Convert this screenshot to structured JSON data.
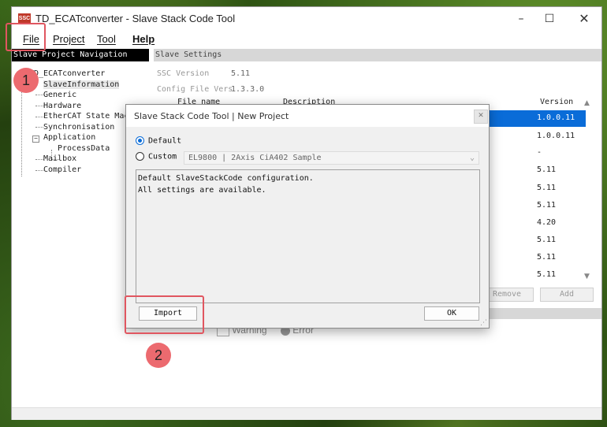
{
  "window": {
    "app_icon_text": "SSC",
    "title": "TD_ECATconverter - Slave Stack Code Tool",
    "controls": {
      "minimize": "–",
      "maximize": "☐",
      "close": "✕"
    }
  },
  "menubar": {
    "items": [
      {
        "label": "File"
      },
      {
        "label": "Project"
      },
      {
        "label": "Tool"
      },
      {
        "label": "Help"
      }
    ]
  },
  "navigation": {
    "header": "Slave Project Navigation",
    "tree": [
      {
        "label": "TD_ECATconverter"
      },
      {
        "label": "SlaveInformation"
      },
      {
        "label": "Generic"
      },
      {
        "label": "Hardware"
      },
      {
        "label": "EtherCAT State Machine"
      },
      {
        "label": "Synchronisation"
      },
      {
        "label": "Application"
      },
      {
        "label": "ProcessData"
      },
      {
        "label": "Mailbox"
      },
      {
        "label": "Compiler"
      }
    ]
  },
  "settings": {
    "header": "Slave Settings",
    "ssc_version_label": "SSC Version",
    "ssc_version_value": "5.11",
    "config_file_label": "Config File Vers",
    "config_file_value": "1.3.3.0",
    "columns": {
      "file_name": "File name",
      "description": "Description",
      "version": "Version"
    },
    "versions": [
      "1.0.0.11",
      "1.0.0.11",
      "-",
      "5.11",
      "5.11",
      "5.11",
      "4.20",
      "5.11",
      "5.11",
      "5.11"
    ],
    "remove_label": "Remove",
    "add_label": "Add"
  },
  "status": {
    "warning": "Warning",
    "error": "Error"
  },
  "dialog": {
    "title": "Slave Stack Code Tool | New Project",
    "default_label": "Default",
    "custom_label": "Custom",
    "custom_selected": "EL9800 | 2Axis CiA402 Sample",
    "description_lines": [
      "Default SlaveStackCode configuration.",
      "All settings are available."
    ],
    "import_label": "Import",
    "ok_label": "OK",
    "close_label": "✕"
  },
  "annotations": {
    "badge_1": "1",
    "badge_2": "2",
    "accent_color": "#e05660"
  }
}
